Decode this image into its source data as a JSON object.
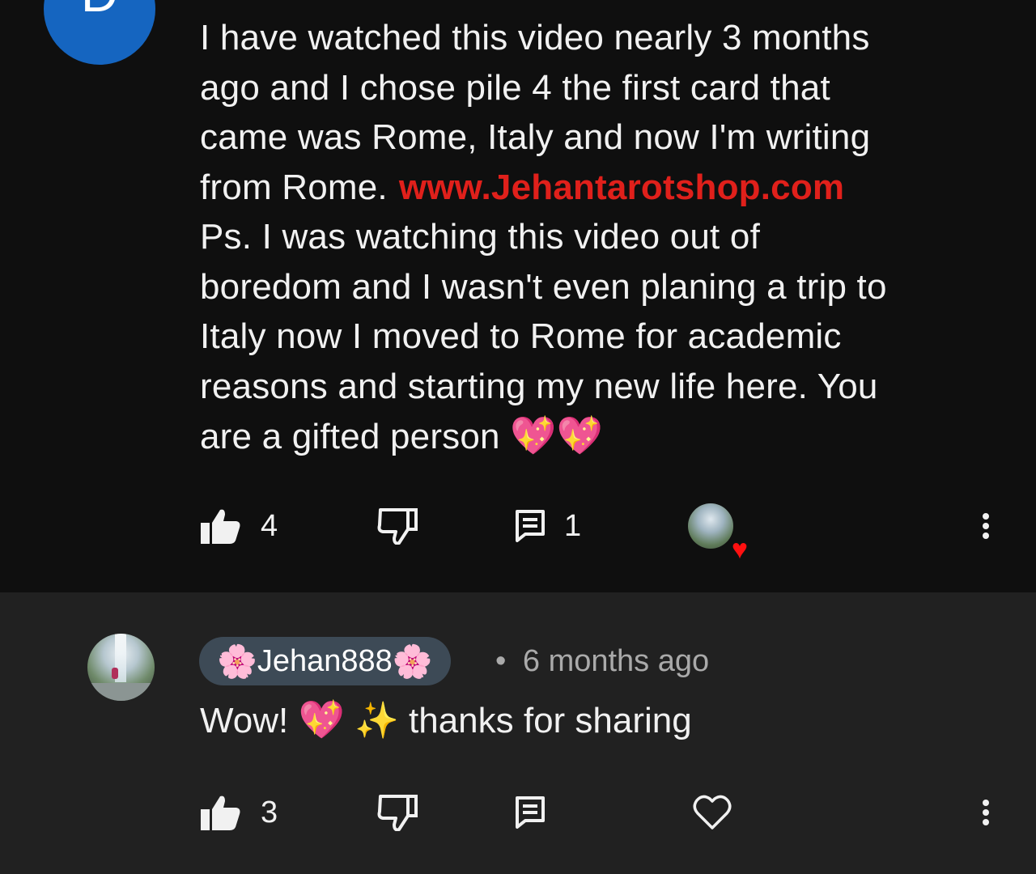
{
  "top_comment": {
    "avatar_letter": "D",
    "lines": [
      "I have watched this video nearly 3 months",
      "ago and I chose pile 4 the first card that",
      "came was Rome, Italy and now I'm writing",
      "from Rome.",
      "Ps. I was watching this video out of",
      "boredom and I wasn't even planing a trip to",
      "Italy now I moved to Rome for academic",
      "reasons and starting my new life here. You",
      "are a gifted person"
    ],
    "link_text": "www.Jehantarotshop.com",
    "end_emoji": "💖💖",
    "like_count": "4",
    "reply_count": "1",
    "icons": {
      "like": "thumbs-up-icon",
      "dislike": "thumbs-down-icon",
      "reply": "comment-icon",
      "creator_heart": "creator-heart-icon",
      "more": "more-vertical-icon"
    }
  },
  "reply": {
    "author": "Jehan888",
    "author_emoji": "🌸",
    "separator": "•",
    "time": "6 months ago",
    "text_prefix": "Wow!",
    "text_emoji": "💖",
    "sparkle": "✨",
    "text_suffix": "thanks for sharing",
    "like_count": "3",
    "icons": {
      "like": "thumbs-up-icon",
      "dislike": "thumbs-down-icon",
      "reply": "comment-icon",
      "heart": "heart-outline-icon",
      "more": "more-vertical-icon"
    }
  },
  "colors": {
    "background_top": "#0f0f0f",
    "background_reply": "#212121",
    "link": "#e0201b",
    "avatar_blue": "#1565c0",
    "creator_heart": "#ff1010",
    "author_chip": "#3d4a56"
  }
}
